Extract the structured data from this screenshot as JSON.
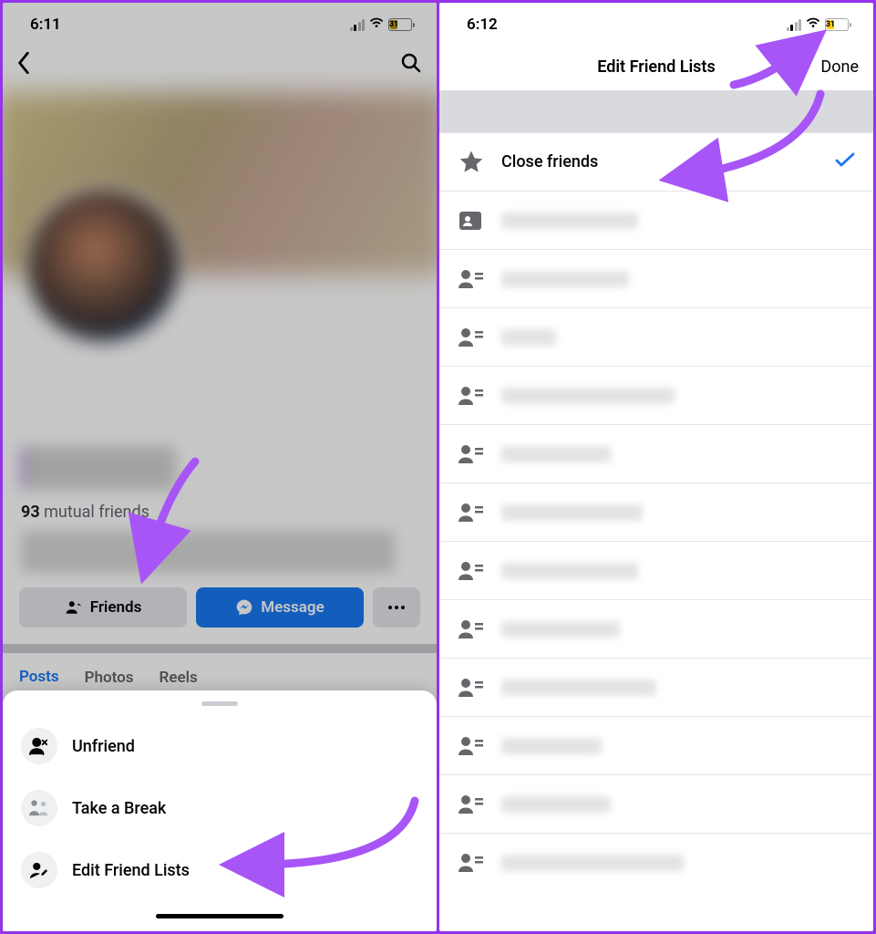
{
  "left": {
    "status": {
      "time": "6:11",
      "battery_pct": "31"
    },
    "mutual_count": "93",
    "mutual_label": " mutual friends",
    "buttons": {
      "friends": "Friends",
      "message": "Message"
    },
    "tabs": {
      "posts": "Posts",
      "photos": "Photos",
      "reels": "Reels"
    },
    "sheet": {
      "unfriend": "Unfriend",
      "take_break": "Take a Break",
      "edit_lists": "Edit Friend Lists"
    }
  },
  "right": {
    "status": {
      "time": "6:12",
      "battery_pct": "31"
    },
    "title": "Edit Friend Lists",
    "done": "Done",
    "close_friends": "Close friends"
  }
}
